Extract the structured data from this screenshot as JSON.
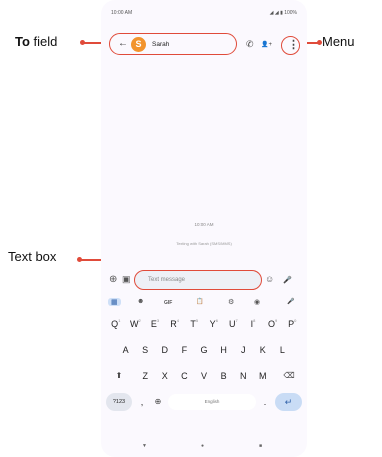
{
  "status_bar": {
    "time": "10:00 AM",
    "icons": "◢ ◢ ▮ 100%"
  },
  "topbar": {
    "back_icon": "←",
    "avatar_letter": "S",
    "contact_name": "Sarah",
    "call_icon": "✆",
    "add_person_icon": "👤+",
    "menu_icon": "⋮"
  },
  "conversation": {
    "timestamp": "10:00 AM",
    "note": "Texting with Sarah (SMS/MMS)"
  },
  "compose": {
    "add_icon": "⊕",
    "gallery_icon": "▣",
    "placeholder": "Text message",
    "emoji_icon": "☺",
    "mic_icon": "🎤"
  },
  "suggestion_bar": {
    "grid_icon": "▦",
    "sticker_icon": "☻",
    "gif_label": "GIF",
    "clipboard_icon": "📋",
    "settings_icon": "⚙",
    "palette_icon": "◉",
    "mic_icon": "🎤"
  },
  "keyboard": {
    "row1": [
      {
        "key": "Q",
        "sup": "1"
      },
      {
        "key": "W",
        "sup": "2"
      },
      {
        "key": "E",
        "sup": "3"
      },
      {
        "key": "R",
        "sup": "4"
      },
      {
        "key": "T",
        "sup": "5"
      },
      {
        "key": "Y",
        "sup": "6"
      },
      {
        "key": "U",
        "sup": "7"
      },
      {
        "key": "I",
        "sup": "8"
      },
      {
        "key": "O",
        "sup": "9"
      },
      {
        "key": "P",
        "sup": "0"
      }
    ],
    "row2": [
      "A",
      "S",
      "D",
      "F",
      "G",
      "H",
      "J",
      "K",
      "L"
    ],
    "row3": [
      "Z",
      "X",
      "C",
      "V",
      "B",
      "N",
      "M"
    ],
    "shift_icon": "⬆",
    "backspace_icon": "⌫",
    "symbols_label": "?123",
    "comma": ",",
    "globe_icon": "⊕",
    "space_label": "English",
    "period": ".",
    "enter_icon": "↵"
  },
  "nav_bar": {
    "back": "▼",
    "home": "●",
    "recents": "■"
  },
  "callouts": {
    "to_bold": "To",
    "to_rest": " field",
    "menu": "Menu",
    "text_box": "Text box"
  },
  "colors": {
    "callout": "#e04b3a",
    "avatar": "#f2942d",
    "accent": "#2d5fa8"
  }
}
